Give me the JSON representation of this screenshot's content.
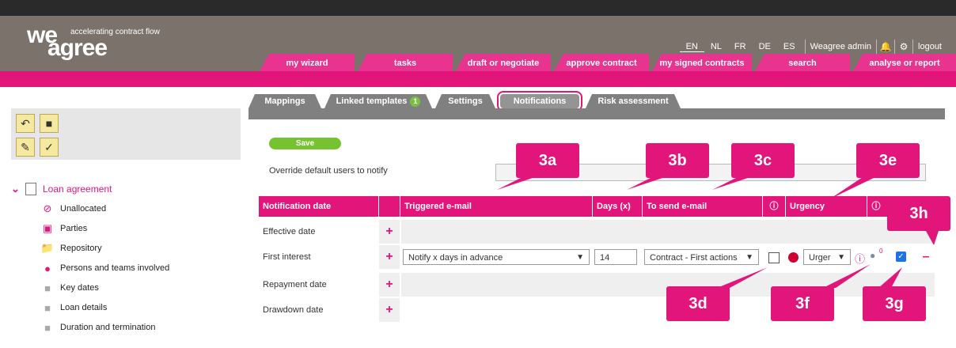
{
  "logo": {
    "line1": "we",
    "line2": "agree",
    "tagline": "accelerating contract flow"
  },
  "header": {
    "languages": [
      "EN",
      "NL",
      "FR",
      "DE",
      "ES"
    ],
    "active_language": "EN",
    "user": "Weagree admin",
    "logout": "logout"
  },
  "nav_tabs": [
    "my wizard",
    "tasks",
    "draft or negotiate",
    "approve contract",
    "my signed contracts",
    "search",
    "analyse or report"
  ],
  "tree": {
    "root": "Loan agreement",
    "items": [
      "Unallocated",
      "Parties",
      "Repository",
      "Persons and teams involved",
      "Key dates",
      "Loan details",
      "Duration and termination"
    ]
  },
  "content_tabs": [
    {
      "label": "Mappings"
    },
    {
      "label": "Linked templates",
      "badge": "1"
    },
    {
      "label": "Settings"
    },
    {
      "label": "Notifications"
    },
    {
      "label": "Risk assessment"
    }
  ],
  "save_label": "Save",
  "override_label": "Override default users to notify",
  "table": {
    "headers": [
      "Notification date",
      "Triggered e-mail",
      "Days (x)",
      "To send e-mail",
      "Urgency"
    ],
    "rows": [
      "Effective date",
      "First interest",
      "Repayment date",
      "Drawdown date"
    ],
    "first_interest": {
      "triggered_email": "Notify x days in advance",
      "days": "14",
      "to_send": "Contract - First actions",
      "urgency": "Urger",
      "team_count": "0"
    }
  },
  "callouts": [
    "3a",
    "3b",
    "3c",
    "3e",
    "3h",
    "3d",
    "3f",
    "3g"
  ],
  "colors": {
    "brand_pink": "#e2157b",
    "header_gray": "#7b726b",
    "save_green": "#77c230"
  }
}
